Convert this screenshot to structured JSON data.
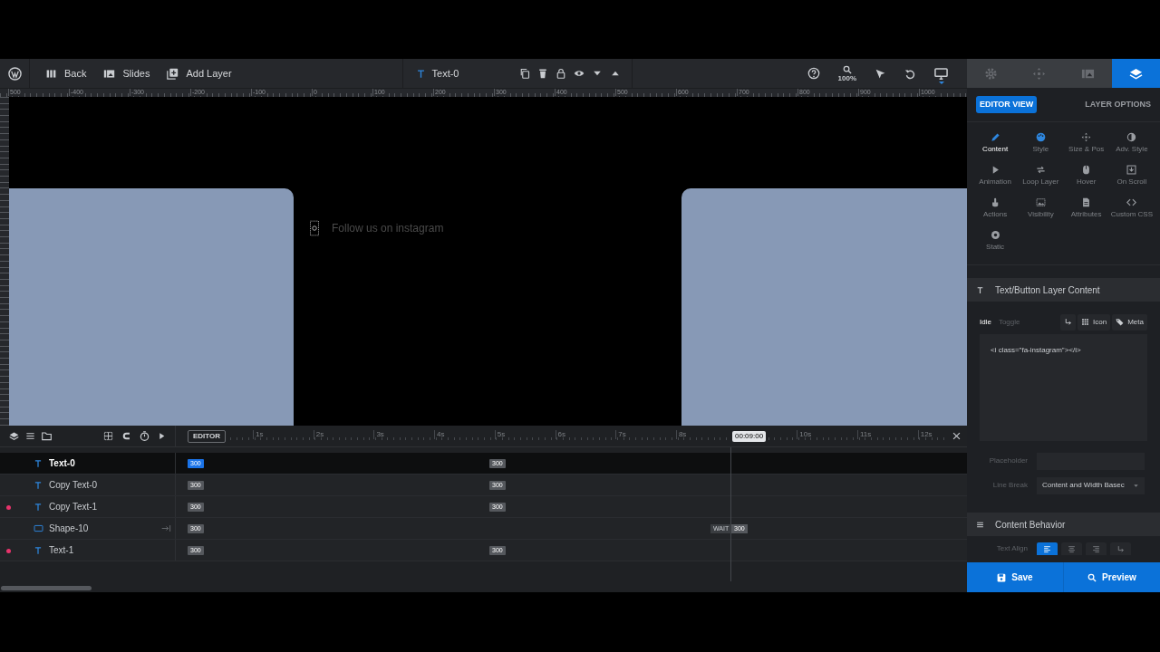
{
  "top_bar": {
    "nav": [
      {
        "kind": "columns",
        "label": "Back"
      },
      {
        "kind": "slides",
        "label": "Slides"
      },
      {
        "kind": "add",
        "label": "Add Layer"
      }
    ],
    "layer_name": "Text-0",
    "zoom": "100%"
  },
  "panel_tabs": [
    {
      "kind": "gear",
      "selected": false
    },
    {
      "kind": "move",
      "selected": false
    },
    {
      "kind": "slides",
      "selected": false
    },
    {
      "kind": "layers",
      "selected": true
    }
  ],
  "ruler": {
    "labels": [
      "500",
      "-400",
      "-300",
      "-200",
      "-100",
      "0",
      "100",
      "200",
      "300",
      "400",
      "500",
      "600",
      "700",
      "800",
      "900",
      "1000"
    ]
  },
  "canvas": {
    "text": "Follow us on instagram"
  },
  "panel": {
    "view_button": "EDITOR VIEW",
    "heading": "LAYER OPTIONS",
    "options": [
      {
        "kind": "pencil",
        "label": "Content",
        "selected": true,
        "hovered": false
      },
      {
        "kind": "palette",
        "label": "Style",
        "selected": false,
        "hovered": true
      },
      {
        "kind": "move",
        "label": "Size & Pos",
        "selected": false,
        "hovered": false
      },
      {
        "kind": "contrast",
        "label": "Adv. Style",
        "selected": false,
        "hovered": false
      },
      {
        "kind": "play",
        "label": "Animation",
        "selected": false,
        "hovered": false
      },
      {
        "kind": "loop",
        "label": "Loop Layer",
        "selected": false,
        "hovered": false
      },
      {
        "kind": "mouse",
        "label": "Hover",
        "selected": false,
        "hovered": false
      },
      {
        "kind": "scroll",
        "label": "On Scroll",
        "selected": false,
        "hovered": false
      },
      {
        "kind": "hand",
        "label": "Actions",
        "selected": false,
        "hovered": false
      },
      {
        "kind": "image",
        "label": "Visibility",
        "selected": false,
        "hovered": false
      },
      {
        "kind": "file",
        "label": "Attributes",
        "selected": false,
        "hovered": false
      },
      {
        "kind": "code",
        "label": "Custom CSS",
        "selected": false,
        "hovered": false
      },
      {
        "kind": "disc",
        "label": "Static",
        "selected": false,
        "hovered": false
      }
    ],
    "content_section": {
      "title": "Text/Button Layer Content",
      "modes": [
        {
          "label": "Idle",
          "selected": true
        },
        {
          "label": "Toggle",
          "selected": false
        }
      ],
      "tools": [
        {
          "kind": "linebreak"
        },
        {
          "kind": "grid",
          "label": "Icon"
        },
        {
          "kind": "tag",
          "label": "Meta"
        }
      ],
      "content": "<i class=\"fa-instagram\"></i>",
      "placeholder_label": "Placeholder",
      "line_break_label": "Line Break",
      "line_break_value": "Content and Width Basec"
    },
    "behavior_section": {
      "title": "Content Behavior",
      "text_align_label": "Text Align",
      "align_buttons": [
        {
          "kind": "left",
          "selected": true
        },
        {
          "kind": "center",
          "selected": false
        },
        {
          "kind": "right",
          "selected": false
        },
        {
          "kind": "break",
          "selected": false
        }
      ]
    },
    "save": "Save",
    "preview": "Preview"
  },
  "timeline": {
    "mode": "EDITOR",
    "seconds": [
      "1s",
      "2s",
      "3s",
      "4s",
      "5s",
      "6s",
      "7s",
      "8s",
      "10s",
      "11s",
      "12s"
    ],
    "current_time": "00:09:00",
    "layers": [
      {
        "kind": "text",
        "name": "Text-0",
        "selected": true,
        "marked": false,
        "blocks": [
          "300",
          "300"
        ],
        "wait": false
      },
      {
        "kind": "text",
        "name": "Copy Text-0",
        "selected": false,
        "marked": false,
        "blocks": [
          "300",
          "300"
        ],
        "wait": false
      },
      {
        "kind": "text",
        "name": "Copy Text-1",
        "selected": false,
        "marked": true,
        "blocks": [
          "300",
          "300"
        ],
        "wait": false
      },
      {
        "kind": "shape",
        "name": "Shape-10",
        "selected": false,
        "marked": false,
        "blocks": [
          "300"
        ],
        "wait": "WAIT",
        "end_block": "300"
      },
      {
        "kind": "text",
        "name": "Text-1",
        "selected": false,
        "marked": true,
        "blocks": [
          "300",
          "300"
        ],
        "wait": false
      }
    ]
  }
}
